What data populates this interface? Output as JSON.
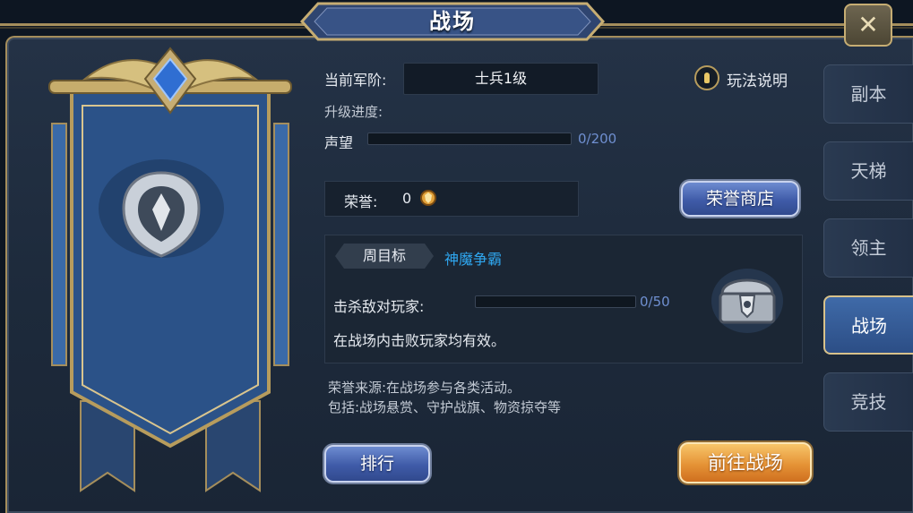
{
  "window": {
    "title": "战场"
  },
  "colors": {
    "accent_gold": "#c6ad73",
    "primary_blue": "#3f5ba8",
    "link_blue": "#2fa7f0",
    "cta_orange": "#e59336"
  },
  "icons": {
    "close": "close-icon",
    "help": "help-icon",
    "honor": "honor-coin-icon",
    "emblem": "shield-emblem-icon",
    "chest": "treasure-chest-icon"
  },
  "rank": {
    "label": "当前军阶:",
    "value": "士兵1级"
  },
  "help": {
    "label": "玩法说明"
  },
  "upgrade": {
    "label": "升级进度:"
  },
  "reputation": {
    "label": "声望",
    "current": 0,
    "max": 200,
    "text": "0/200",
    "fraction": 0
  },
  "honor": {
    "label": "荣誉:",
    "value": "0"
  },
  "buttons": {
    "honor_shop": "荣誉商店",
    "ranking": "排行",
    "go_battlefield": "前往战场"
  },
  "weekly_goal": {
    "tag": "周目标",
    "mode": "神魔争霸",
    "task_label": "击杀敌对玩家:",
    "progress_text": "0/50",
    "current": 0,
    "max": 50,
    "fraction": 0,
    "description": "在战场内击败玩家均有效。"
  },
  "honor_source": {
    "line1": "荣誉来源:在战场参与各类活动。",
    "line2": "包括:战场悬赏、守护战旗、物资掠夺等"
  },
  "tabs": [
    {
      "label": "副本",
      "active": false
    },
    {
      "label": "天梯",
      "active": false
    },
    {
      "label": "领主",
      "active": false
    },
    {
      "label": "战场",
      "active": true
    },
    {
      "label": "竞技",
      "active": false
    }
  ]
}
